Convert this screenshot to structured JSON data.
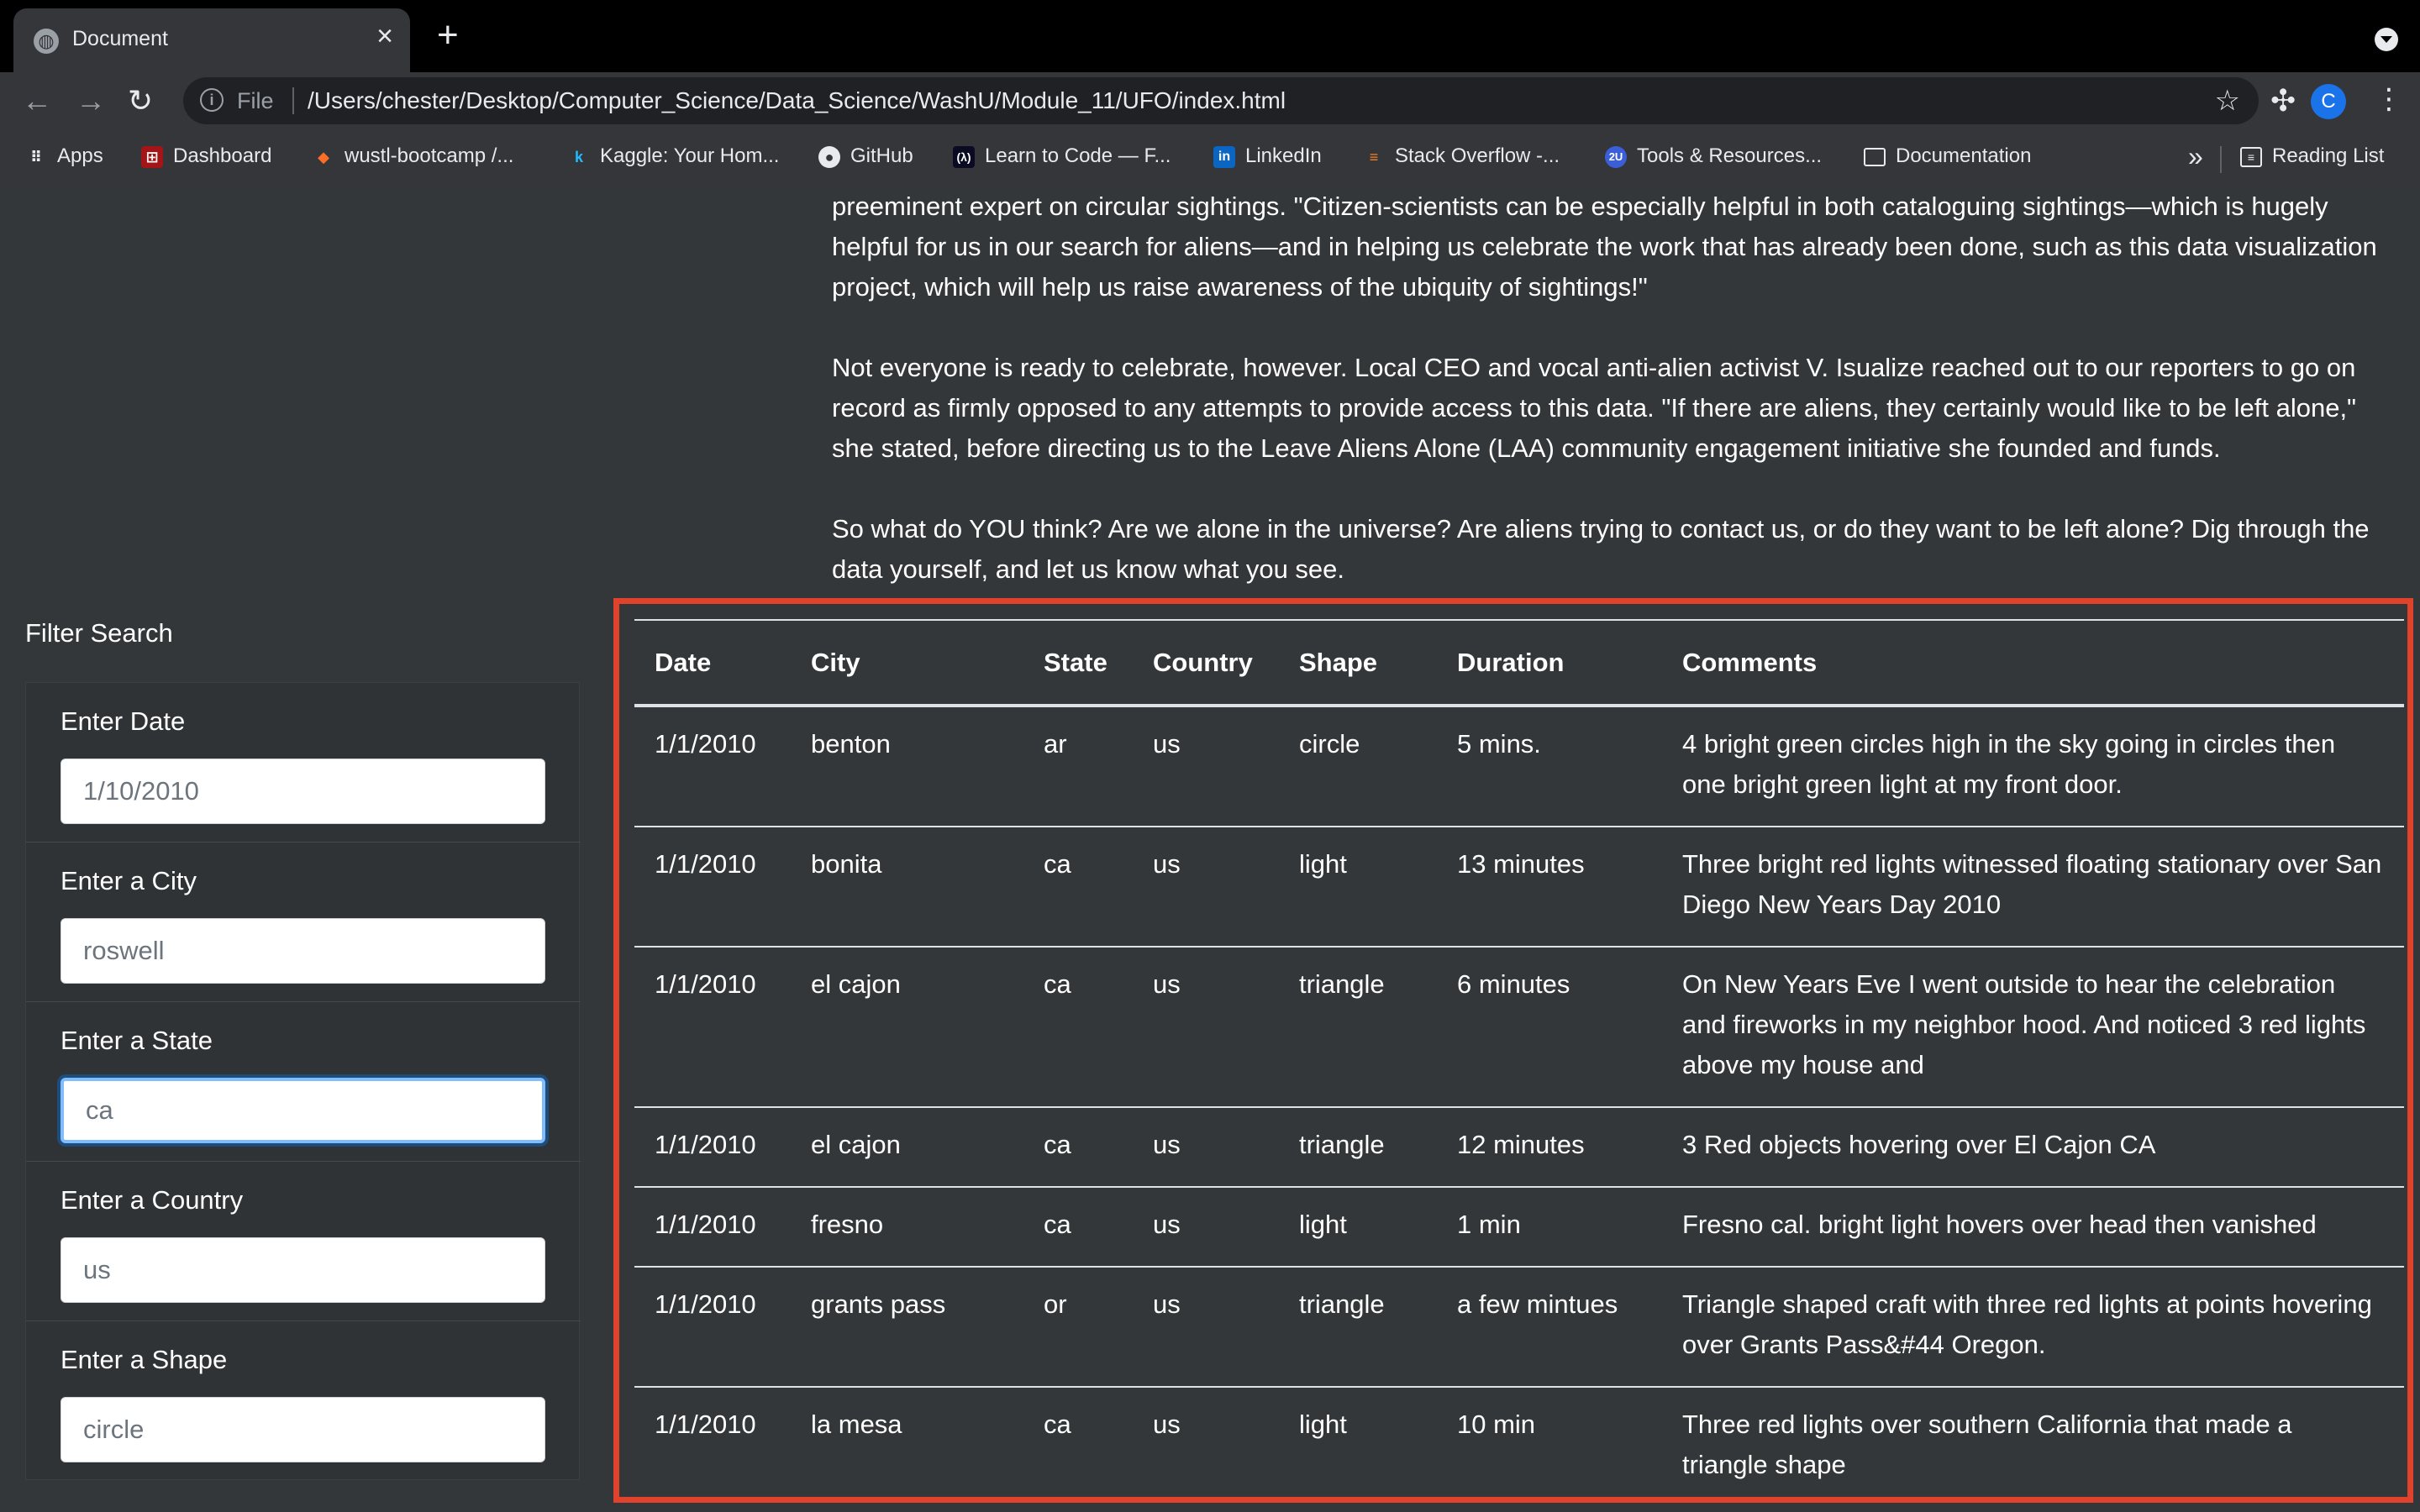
{
  "browser": {
    "tab_title": "Document",
    "url_scheme": "File",
    "url": "/Users/chester/Desktop/Computer_Science/Data_Science/WashU/Module_11/UFO/index.html",
    "profile_initial": "C",
    "bookmarks": [
      "Apps",
      "Dashboard",
      "wustl-bootcamp /...",
      "Kaggle: Your Hom...",
      "GitHub",
      "Learn to Code — F...",
      "LinkedIn",
      "Stack Overflow -...",
      "Tools & Resources...",
      "Documentation"
    ],
    "bookmarks_overflow": "»",
    "reading_list": "Reading List"
  },
  "article": {
    "p1": "preeminent expert on circular sightings. \"Citizen-scientists can be especially helpful in both cataloguing sightings—which is hugely helpful for us in our search for aliens—and in helping us celebrate the work that has already been done, such as this data visualization project, which will help us raise awareness of the ubiquity of sightings!\"",
    "p2": "Not everyone is ready to celebrate, however. Local CEO and vocal anti-alien activist V. Isualize reached out to our reporters to go on record as firmly opposed to any attempts to provide access to this data. \"If there are aliens, they certainly would like to be left alone,\" she stated, before directing us to the Leave Aliens Alone (LAA) community engagement initiative she founded and funds.",
    "p3": "So what do YOU think? Are we alone in the universe? Are aliens trying to contact us, or do they want to be left alone? Dig through the data yourself, and let us know what you see."
  },
  "filter": {
    "title": "Filter Search",
    "fields": [
      {
        "label": "Enter Date",
        "value": "1/10/2010"
      },
      {
        "label": "Enter a City",
        "value": "roswell"
      },
      {
        "label": "Enter a State",
        "value": "ca"
      },
      {
        "label": "Enter a Country",
        "value": "us"
      },
      {
        "label": "Enter a Shape",
        "value": "circle"
      }
    ]
  },
  "table": {
    "headers": [
      "Date",
      "City",
      "State",
      "Country",
      "Shape",
      "Duration",
      "Comments"
    ],
    "rows": [
      [
        "1/1/2010",
        "benton",
        "ar",
        "us",
        "circle",
        "5 mins.",
        "4 bright green circles high in the sky going in circles then one bright green light at my front door."
      ],
      [
        "1/1/2010",
        "bonita",
        "ca",
        "us",
        "light",
        "13 minutes",
        "Three bright red lights witnessed floating stationary over San Diego New Years Day 2010"
      ],
      [
        "1/1/2010",
        "el cajon",
        "ca",
        "us",
        "triangle",
        "6 minutes",
        "On New Years Eve I went outside to hear the celebration and fireworks in my neighbor hood. And noticed 3 red lights above my house and"
      ],
      [
        "1/1/2010",
        "el cajon",
        "ca",
        "us",
        "triangle",
        "12 minutes",
        "3 Red objects hovering over El Cajon CA"
      ],
      [
        "1/1/2010",
        "fresno",
        "ca",
        "us",
        "light",
        "1 min",
        "Fresno cal. bright light hovers over head then vanished"
      ],
      [
        "1/1/2010",
        "grants pass",
        "or",
        "us",
        "triangle",
        "a few mintues",
        "Triangle shaped craft with three red lights at points hovering over Grants Pass&#44 Oregon."
      ],
      [
        "1/1/2010",
        "la mesa",
        "ca",
        "us",
        "light",
        "10 min",
        "Three red lights over southern California that made a triangle shape"
      ]
    ]
  }
}
